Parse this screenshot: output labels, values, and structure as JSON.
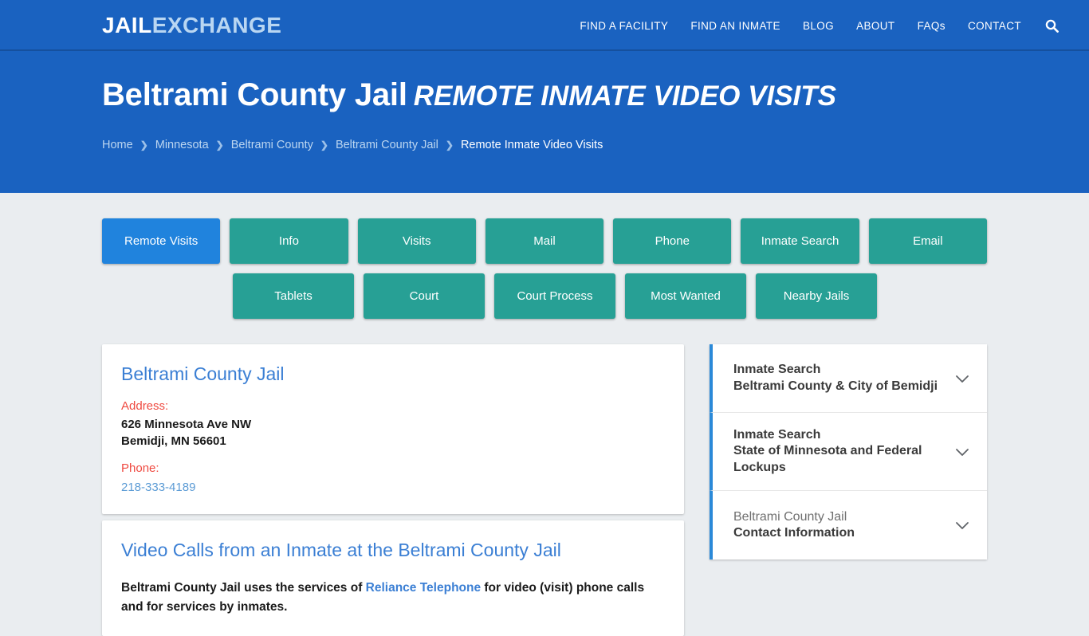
{
  "brand": {
    "logo_part1": "JAIL",
    "logo_part2": "EXCHANGE"
  },
  "nav": {
    "items": [
      {
        "label": "FIND A FACILITY"
      },
      {
        "label": "FIND AN INMATE"
      },
      {
        "label": "BLOG"
      },
      {
        "label": "ABOUT"
      },
      {
        "label": "FAQs"
      },
      {
        "label": "CONTACT"
      }
    ],
    "search_icon": "search-icon"
  },
  "hero": {
    "title_main": "Beltrami County Jail",
    "title_sub": "REMOTE INMATE VIDEO VISITS",
    "breadcrumb": [
      {
        "label": "Home",
        "current": false
      },
      {
        "label": "Minnesota",
        "current": false
      },
      {
        "label": "Beltrami County",
        "current": false
      },
      {
        "label": "Beltrami County Jail",
        "current": false
      },
      {
        "label": "Remote Inmate Video Visits",
        "current": true
      }
    ],
    "breadcrumb_separator": "❯"
  },
  "section_buttons": {
    "row1": [
      {
        "label": "Remote Visits",
        "active": true
      },
      {
        "label": "Info",
        "active": false
      },
      {
        "label": "Visits",
        "active": false
      },
      {
        "label": "Mail",
        "active": false
      },
      {
        "label": "Phone",
        "active": false
      },
      {
        "label": "Inmate Search",
        "active": false
      },
      {
        "label": "Email",
        "active": false
      }
    ],
    "row2": [
      {
        "label": "Tablets",
        "active": false
      },
      {
        "label": "Court",
        "active": false
      },
      {
        "label": "Court Process",
        "active": false
      },
      {
        "label": "Most Wanted",
        "active": false
      },
      {
        "label": "Nearby Jails",
        "active": false
      }
    ]
  },
  "facility_card": {
    "name": "Beltrami County Jail",
    "address_label": "Address:",
    "address_line1": "626 Minnesota Ave NW",
    "address_line2": "Bemidji, MN 56601",
    "phone_label": "Phone:",
    "phone": "218-333-4189"
  },
  "article": {
    "title": "Video Calls from an Inmate at the Beltrami County Jail",
    "body_part1": "Beltrami County Jail uses the services of ",
    "body_link": "Reliance Telephone",
    "body_part2": " for video (visit)",
    "body_line2": "phone calls and for services by inmates."
  },
  "sidebar": {
    "accordion": [
      {
        "line1": "Inmate Search",
        "line2": "Beltrami County & City of Bemidji",
        "line1_muted": false,
        "icon": "chevron-down-icon"
      },
      {
        "line1": "Inmate Search",
        "line2": "State of Minnesota and Federal Lockups",
        "line1_muted": false,
        "icon": "chevron-down-icon"
      },
      {
        "line1": "Beltrami County Jail",
        "line2": "Contact Information",
        "line1_muted": true,
        "icon": "chevron-down-icon"
      }
    ]
  },
  "colors": {
    "header_blue": "#1a62c0",
    "active_button_blue": "#2083dd",
    "teal_button": "#27a095",
    "page_background": "#eaedf0",
    "link_blue": "#3b7fd4",
    "label_red": "#ef4a41",
    "accent_border": "#2a89d8"
  }
}
